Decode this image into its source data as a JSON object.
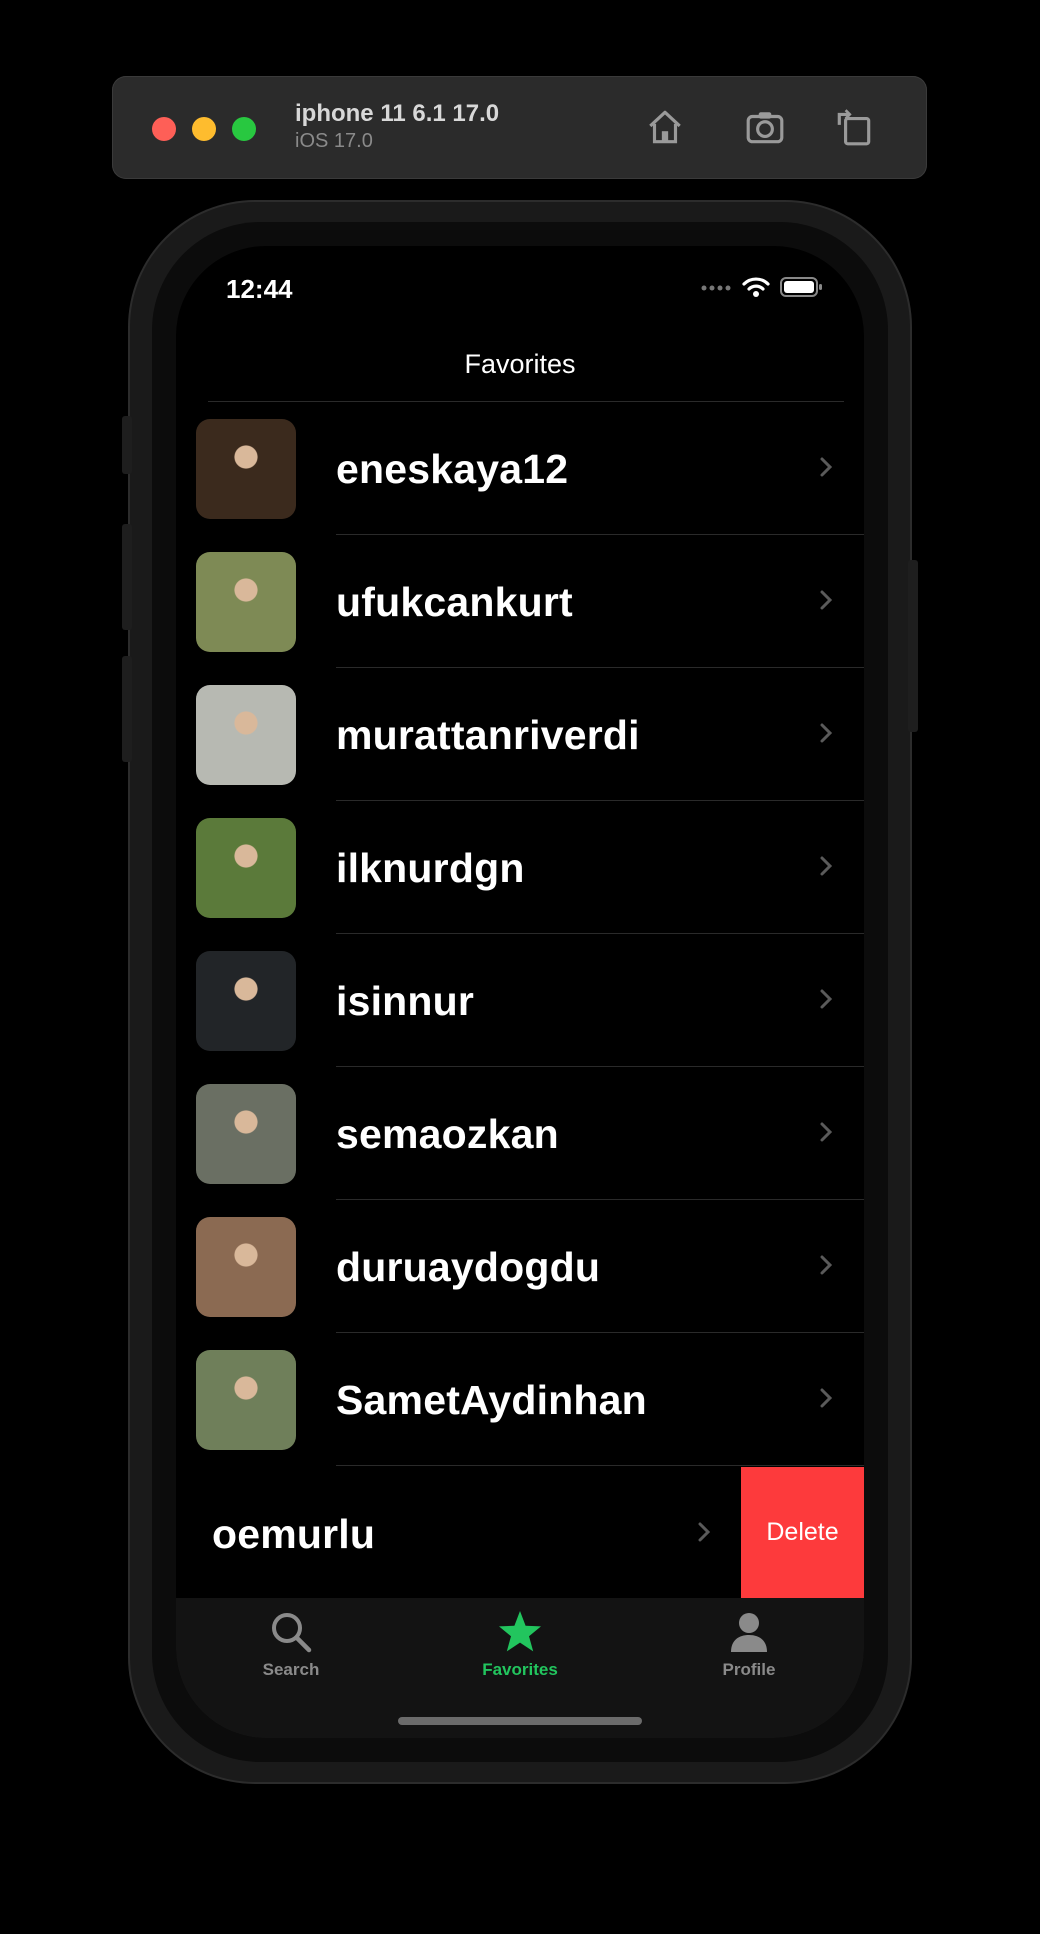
{
  "simulator": {
    "device_name": "iphone 11 6.1 17.0",
    "os_version": "iOS 17.0",
    "controls": [
      "home-icon",
      "screenshot-icon",
      "rotate-icon"
    ]
  },
  "status_bar": {
    "time": "12:44",
    "icons": [
      "signal-icon",
      "wifi-icon",
      "battery-icon"
    ]
  },
  "nav": {
    "title": "Favorites"
  },
  "favorites": [
    {
      "username": "eneskaya12",
      "avatar_color": "#3b2a1d"
    },
    {
      "username": "ufukcankurt",
      "avatar_color": "#7e8a55"
    },
    {
      "username": "murattanriverdi",
      "avatar_color": "#b7b9b2"
    },
    {
      "username": "ilknurdgn",
      "avatar_color": "#5b7a3a"
    },
    {
      "username": "isinnur",
      "avatar_color": "#222528"
    },
    {
      "username": "semaozkan",
      "avatar_color": "#6a6f63"
    },
    {
      "username": "duruaydogdu",
      "avatar_color": "#8b6a52"
    },
    {
      "username": "SametAydinhan",
      "avatar_color": "#6f7f5a"
    }
  ],
  "swiped_row": {
    "username": "oemurlu",
    "delete_label": "Delete",
    "delete_color": "#fd3a3c"
  },
  "tabs": [
    {
      "label": "Search",
      "icon": "search-icon",
      "active": false
    },
    {
      "label": "Favorites",
      "icon": "star-icon",
      "active": true
    },
    {
      "label": "Profile",
      "icon": "person-icon",
      "active": false
    }
  ],
  "colors": {
    "accent": "#22c55e",
    "background": "#000000"
  }
}
